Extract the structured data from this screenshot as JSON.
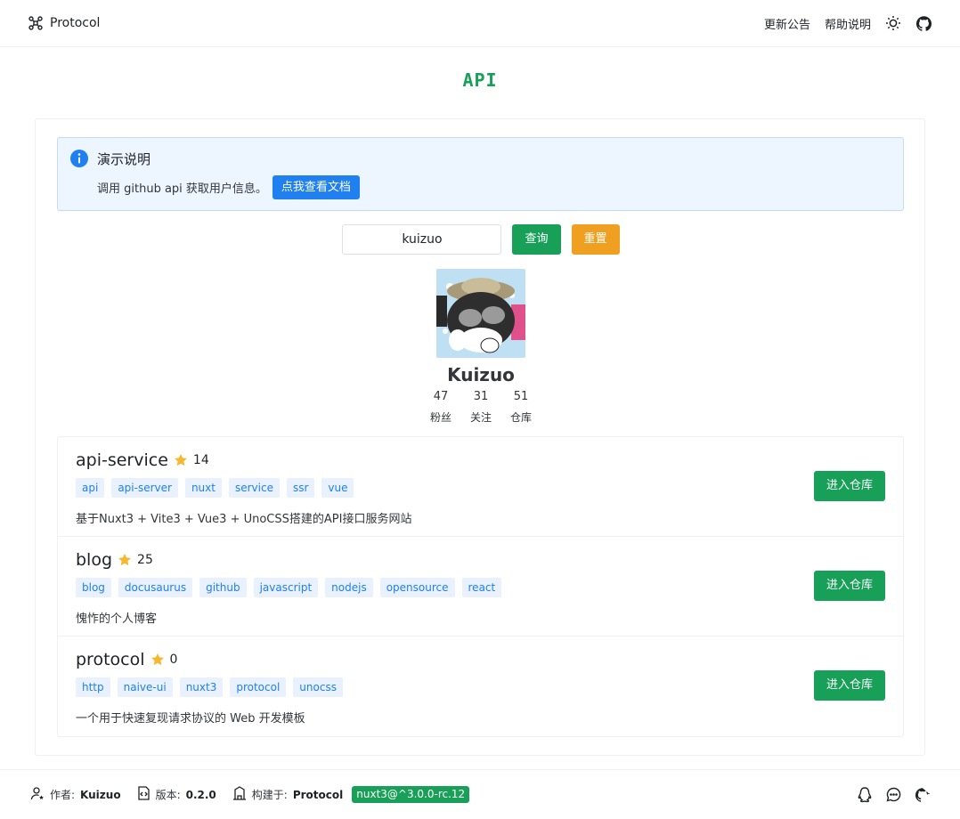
{
  "header": {
    "brand": "Protocol",
    "nav": [
      "更新公告",
      "帮助说明"
    ],
    "icons": [
      "logo-icon",
      "sun-icon",
      "github-icon"
    ]
  },
  "page": {
    "title": "API"
  },
  "alert": {
    "title": "演示说明",
    "body": "调用 github api 获取用户信息。",
    "button": "点我查看文档"
  },
  "search": {
    "value": "kuizuo",
    "query_button": "查询",
    "reset_button": "重置"
  },
  "profile": {
    "name": "Kuizuo",
    "stats": [
      {
        "value": "47",
        "label": "粉丝"
      },
      {
        "value": "31",
        "label": "关注"
      },
      {
        "value": "51",
        "label": "仓库"
      }
    ]
  },
  "repos": [
    {
      "name": "api-service",
      "stars": "14",
      "tags": [
        "api",
        "api-server",
        "nuxt",
        "service",
        "ssr",
        "vue"
      ],
      "description": "基于Nuxt3 + Vite3 + Vue3 + UnoCSS搭建的API接口服务网站",
      "button": "进入仓库"
    },
    {
      "name": "blog",
      "stars": "25",
      "tags": [
        "blog",
        "docusaurus",
        "github",
        "javascript",
        "nodejs",
        "opensource",
        "react"
      ],
      "description": "愧怍的个人博客",
      "button": "进入仓库"
    },
    {
      "name": "protocol",
      "stars": "0",
      "tags": [
        "http",
        "naive-ui",
        "nuxt3",
        "protocol",
        "unocss"
      ],
      "description": "一个用于快速复现请求协议的 Web 开发模板",
      "button": "进入仓库"
    }
  ],
  "footer": {
    "author_label": "作者:",
    "author_value": "Kuizuo",
    "version_label": "版本:",
    "version_value": "0.2.0",
    "built_label": "构建于:",
    "built_value": "Protocol",
    "built_badge": "nuxt3@^3.0.0-rc.12"
  },
  "colors": {
    "primary": "#18a058",
    "info": "#2080f0",
    "warning": "#f0a020",
    "star": "#f5b82e"
  }
}
